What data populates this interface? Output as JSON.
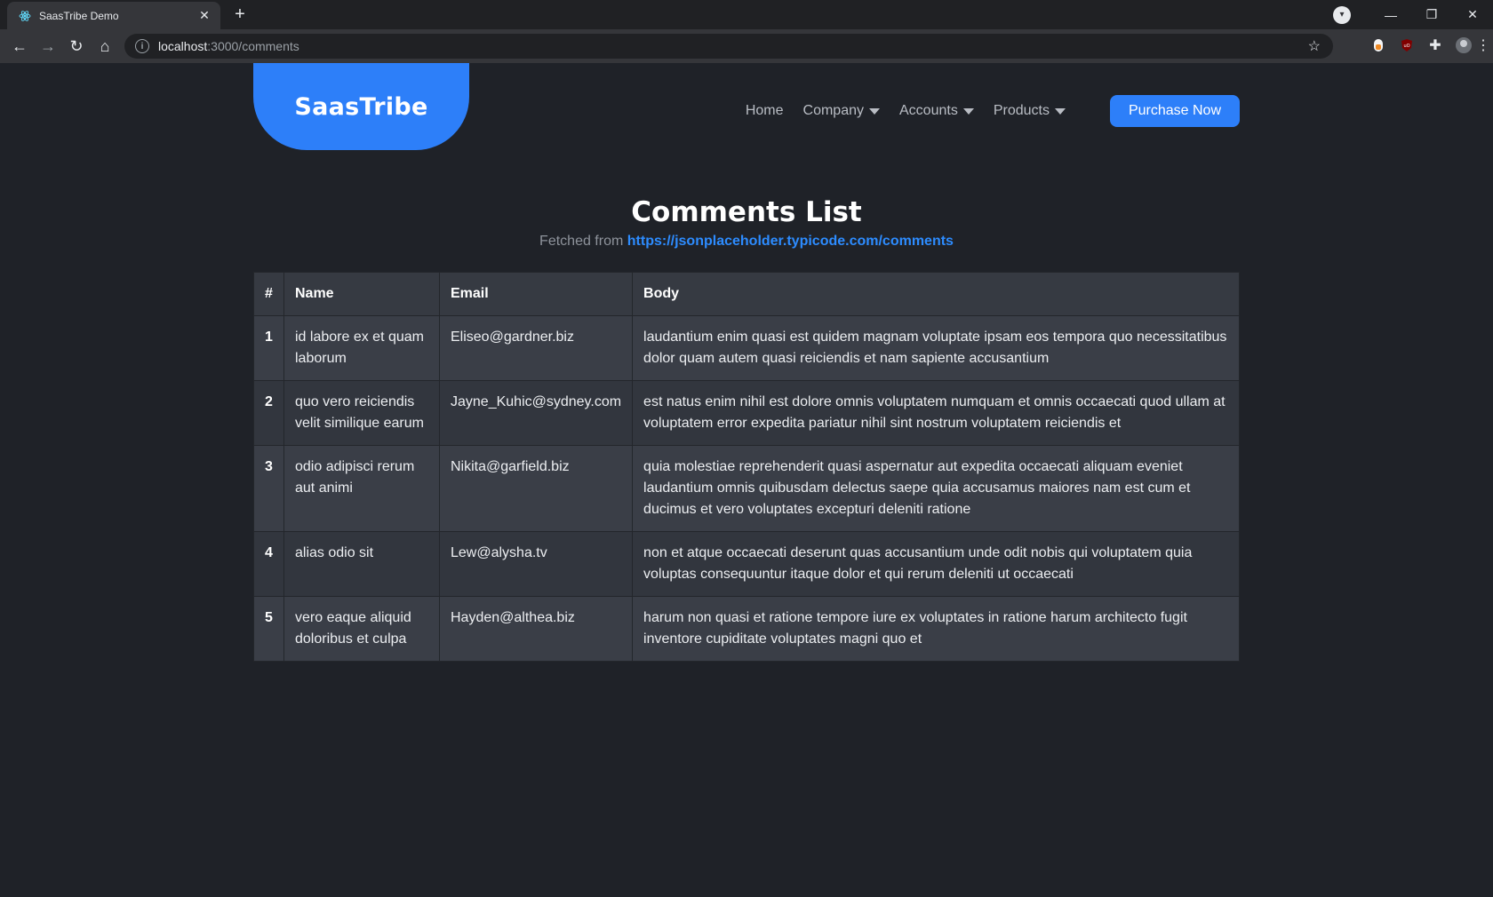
{
  "browser": {
    "tab_title": "SaasTribe Demo",
    "url_host": "localhost",
    "url_path": ":3000/comments"
  },
  "header": {
    "logo": "SaasTribe",
    "nav": [
      {
        "label": "Home",
        "dropdown": false
      },
      {
        "label": "Company",
        "dropdown": true
      },
      {
        "label": "Accounts",
        "dropdown": true
      },
      {
        "label": "Products",
        "dropdown": true
      }
    ],
    "cta_label": "Purchase Now"
  },
  "main": {
    "title": "Comments List",
    "subtitle_prefix": "Fetched from",
    "subtitle_link": "https://jsonplaceholder.typicode.com/comments",
    "table": {
      "headers": [
        "#",
        "Name",
        "Email",
        "Body"
      ],
      "rows": [
        {
          "id": "1",
          "name": "id labore ex et quam laborum",
          "email": "Eliseo@gardner.biz",
          "body": "laudantium enim quasi est quidem magnam voluptate ipsam eos tempora quo necessitatibus dolor quam autem quasi reiciendis et nam sapiente accusantium"
        },
        {
          "id": "2",
          "name": "quo vero reiciendis velit similique earum",
          "email": "Jayne_Kuhic@sydney.com",
          "body": "est natus enim nihil est dolore omnis voluptatem numquam et omnis occaecati quod ullam at voluptatem error expedita pariatur nihil sint nostrum voluptatem reiciendis et"
        },
        {
          "id": "3",
          "name": "odio adipisci rerum aut animi",
          "email": "Nikita@garfield.biz",
          "body": "quia molestiae reprehenderit quasi aspernatur aut expedita occaecati aliquam eveniet laudantium omnis quibusdam delectus saepe quia accusamus maiores nam est cum et ducimus et vero voluptates excepturi deleniti ratione"
        },
        {
          "id": "4",
          "name": "alias odio sit",
          "email": "Lew@alysha.tv",
          "body": "non et atque occaecati deserunt quas accusantium unde odit nobis qui voluptatem quia voluptas consequuntur itaque dolor et qui rerum deleniti ut occaecati"
        },
        {
          "id": "5",
          "name": "vero eaque aliquid doloribus et culpa",
          "email": "Hayden@althea.biz",
          "body": "harum non quasi et ratione tempore iure ex voluptates in ratione harum architecto fugit inventore cupiditate voluptates magni quo et"
        }
      ]
    }
  },
  "colors": {
    "accent": "#2d7ff9",
    "background": "#1f2228",
    "link": "#2d8cff"
  }
}
